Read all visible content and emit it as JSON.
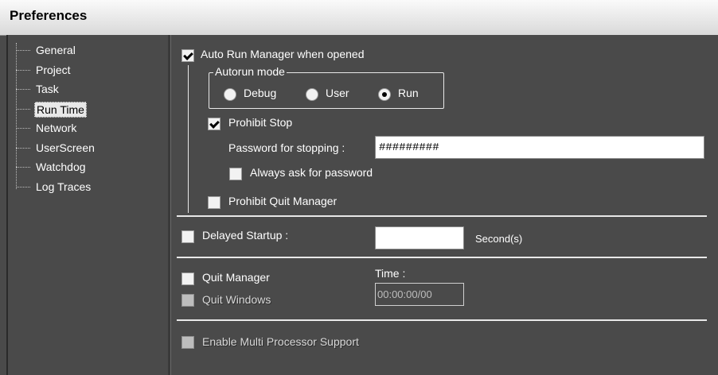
{
  "window": {
    "title": "Preferences"
  },
  "sidebar": {
    "items": [
      {
        "label": "General"
      },
      {
        "label": "Project"
      },
      {
        "label": "Task"
      },
      {
        "label": "Run Time"
      },
      {
        "label": "Network"
      },
      {
        "label": "UserScreen"
      },
      {
        "label": "Watchdog"
      },
      {
        "label": "Log Traces"
      }
    ],
    "selected": "Run Time"
  },
  "runtime": {
    "auto_run": {
      "label": "Auto Run Manager when opened",
      "checked": true
    },
    "autorun_mode": {
      "title": "Autorun mode",
      "options": [
        {
          "label": "Debug",
          "selected": false
        },
        {
          "label": "User",
          "selected": false
        },
        {
          "label": "Run",
          "selected": true
        }
      ]
    },
    "prohibit_stop": {
      "label": "Prohibit Stop",
      "checked": true
    },
    "password": {
      "label": "Password for stopping :",
      "value": "#########"
    },
    "always_ask": {
      "label": "Always ask for password",
      "checked": false
    },
    "prohibit_quit": {
      "label": "Prohibit Quit Manager",
      "checked": false
    },
    "delayed_startup": {
      "label": "Delayed Startup :",
      "value": "",
      "unit": "Second(s)",
      "checked": false
    },
    "quit_manager": {
      "label": "Quit Manager",
      "checked": false
    },
    "quit_windows": {
      "label": "Quit Windows",
      "checked": false,
      "disabled": true
    },
    "time": {
      "label": "Time :",
      "placeholder": "00:00:00/00"
    },
    "multi_processor": {
      "label": "Enable Multi Processor Support",
      "checked": false,
      "disabled": true
    }
  }
}
